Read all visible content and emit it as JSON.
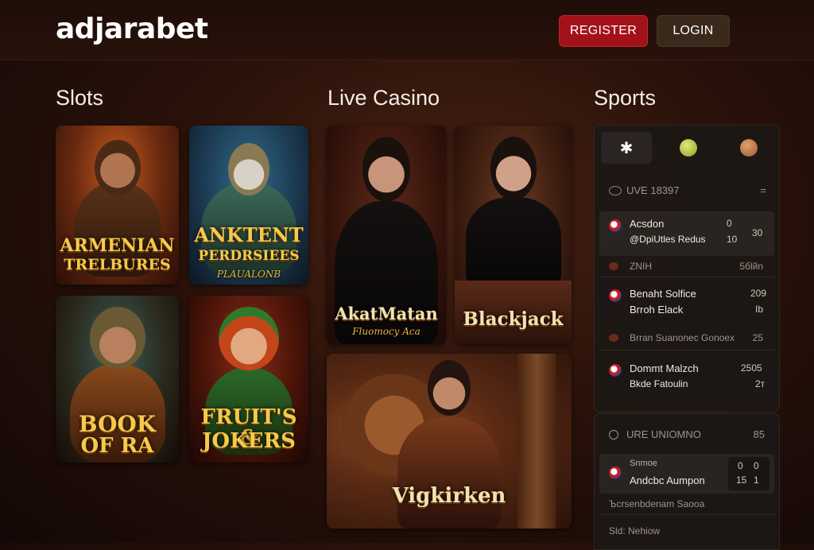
{
  "header": {
    "logo": "adjarabet",
    "register_label": "REGISTER",
    "login_label": "LOGIN"
  },
  "sections": {
    "slots": "Slots",
    "live_casino": "Live Casino",
    "sports": "Sports"
  },
  "slots": [
    {
      "title_line1": "ARMENIAN",
      "title_line2": "TRELBURES",
      "subtitle": ""
    },
    {
      "title_line1": "ANKTENT",
      "title_line2": "PERDRSIEES",
      "subtitle": "PLAUALONB"
    },
    {
      "title_line1": "BOOK",
      "title_line2": "OF RA",
      "subtitle": ""
    },
    {
      "title_line1": "FRUIT'S &",
      "title_line2": "JOKERS",
      "subtitle": ""
    }
  ],
  "live_casino": [
    {
      "title": "AkatMatan",
      "subtitle": "Fluomocy Aca"
    },
    {
      "title": "Blackjack",
      "subtitle": ""
    },
    {
      "title": "Vigkirken",
      "subtitle": ""
    }
  ],
  "sports": {
    "tabs": [
      "football-icon",
      "tennis-ball-icon",
      "basketball-icon"
    ],
    "live_header": {
      "label": "UVE 18397",
      "menu": "="
    },
    "matches": [
      {
        "team1": "Acsdon",
        "team2": "@DpiUtlеs Redus",
        "score1": "0",
        "score2": "10",
        "extra": "30",
        "highlight": true
      },
      {
        "row": "ZNIH",
        "value": "5бlйn"
      },
      {
        "team1": "Benaht Solfice",
        "team2": "Brroh Elack",
        "score1": "209",
        "score2": "Ib",
        "extra": "",
        "highlight": false
      },
      {
        "row": "Brran  Suanonec Gonoex",
        "value": "25"
      },
      {
        "team1": "Dommt Malzch",
        "team2": "Bkde Fatoulin",
        "score1": "2505",
        "score2": "2т",
        "extra": "",
        "highlight": false
      }
    ],
    "upcoming_header": {
      "label": "URE  UNIOMNO",
      "value": "85"
    },
    "upcoming_match": {
      "team1": "Snmoe",
      "team2": "Andcbc Aumpon",
      "s1a": "0",
      "s1b": "0",
      "s2a": "15",
      "s2b": "1"
    },
    "footer_row1": "Ъcrsenbdenam Saooa",
    "footer_row2": "Sld: Nehiow"
  },
  "colors": {
    "brand_red": "#a3121a",
    "gold_title": "#f6c94a",
    "panel_bg": "#1c1816"
  }
}
